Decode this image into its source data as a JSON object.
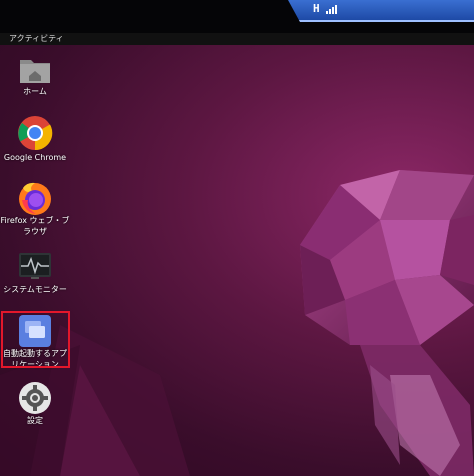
{
  "vnc": {
    "connection_label": "H"
  },
  "topbar": {
    "activities": "アクティビティ"
  },
  "dock": {
    "items": [
      {
        "label": "ホーム",
        "icon": "home-folder-icon"
      },
      {
        "label": "Google Chrome",
        "icon": "chrome-icon"
      },
      {
        "label": "Firefox ウェブ・ブラウザ",
        "icon": "firefox-icon"
      },
      {
        "label": "システムモニター",
        "icon": "system-monitor-icon"
      },
      {
        "label": "自動起動するアプリケーション",
        "icon": "startup-applications-icon"
      },
      {
        "label": "設定",
        "icon": "settings-gear-icon"
      }
    ]
  },
  "colors": {
    "wallpaper_base": "#3a0d2b",
    "wallpaper_accent": "#8c2766",
    "highlight": "#e3172b",
    "vnc_bar": "#2a5cc0"
  }
}
